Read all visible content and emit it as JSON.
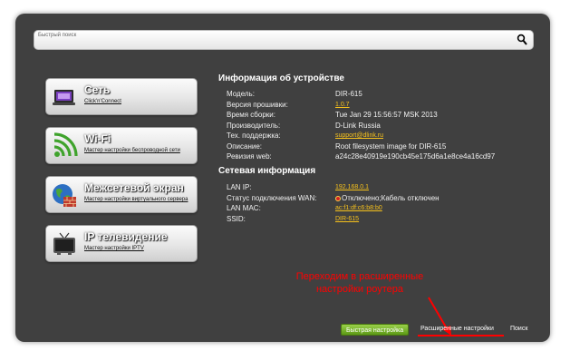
{
  "search": {
    "placeholder": "Быстрый поиск",
    "icon": "search-icon"
  },
  "menu": [
    {
      "title": "Сеть",
      "link": "Click'n'Connect",
      "icon": "network-icon"
    },
    {
      "title": "Wi-Fi",
      "link": "Мастер настройки беспроводной сети",
      "icon": "wifi-icon"
    },
    {
      "title": "Межсетевой экран",
      "link": "Мастер настройки виртуального сервера",
      "icon": "firewall-icon"
    },
    {
      "title": "IP телевидение",
      "link": "Мастер настройки IPTV",
      "icon": "tv-icon"
    }
  ],
  "device_info": {
    "heading": "Информация об устройстве",
    "model_label": "Модель:",
    "model_value": "DIR-615",
    "firmware_label": "Версия прошивки:",
    "firmware_value": "1.0.7",
    "build_label": "Время сборки:",
    "build_value": "Tue Jan 29 15:56:57 MSK 2013",
    "vendor_label": "Производитель:",
    "vendor_value": "D-Link Russia",
    "support_label": "Тех. поддержка:",
    "support_value": "support@dlink.ru",
    "description_label": "Описание:",
    "description_value": "Root filesystem image for DIR-615",
    "web_revision_label": "Ревизия web:",
    "web_revision_value": "a24c28e40919e190cb45e175d6a1e8ce4a16cd97"
  },
  "network_info": {
    "heading": "Сетевая информация",
    "lan_ip_label": "LAN IP:",
    "lan_ip_value": "192.168.0.1",
    "wan_status_label": "Статус подключения WAN:",
    "wan_status_value": "Отключено;Кабель отключен",
    "lan_mac_label": "LAN MAC:",
    "lan_mac_value": "ac:f1:df:c6:b8:b0",
    "ssid_label": "SSID:",
    "ssid_value": "DIR-615"
  },
  "annotation": {
    "line1": "Переходим в расширенные",
    "line2": "настройки роутера",
    "color": "#ff0000"
  },
  "footer": {
    "quick_setup": "Быстрая настройка",
    "advanced": "Расширенные настройки",
    "search": "Поиск"
  },
  "colors": {
    "frame_background": "#404040",
    "link_accent": "#f7c21c",
    "quick_setup_button": "#7cb82f"
  }
}
